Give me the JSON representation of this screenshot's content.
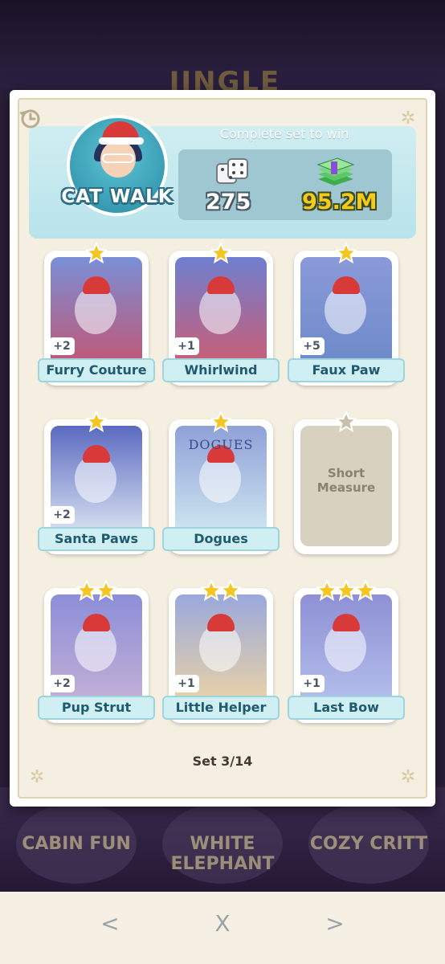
{
  "background": {
    "peek_title": "JINGLE",
    "bottom_sets": [
      "CABIN FUN",
      "WHITE ELEPHANT",
      "COZY CRITT"
    ]
  },
  "header": {
    "set_name": "CAT WALK",
    "complete_text": "Complete set to win",
    "rewards": {
      "dice": "275",
      "money": "95.2M"
    }
  },
  "cards": [
    {
      "name": "Furry Couture",
      "stars": 1,
      "duplicates": "+2",
      "collected": true
    },
    {
      "name": "Whirlwind",
      "stars": 1,
      "duplicates": "+1",
      "collected": true
    },
    {
      "name": "Faux Paw",
      "stars": 1,
      "duplicates": "+5",
      "collected": true
    },
    {
      "name": "Santa Paws",
      "stars": 1,
      "duplicates": "+2",
      "collected": true
    },
    {
      "name": "Dogues",
      "stars": 1,
      "duplicates": "",
      "collected": true,
      "poster_text": "DOGUES"
    },
    {
      "name": "Short Measure",
      "stars": 1,
      "duplicates": "",
      "collected": false
    },
    {
      "name": "Pup Strut",
      "stars": 2,
      "duplicates": "+2",
      "collected": true
    },
    {
      "name": "Little Helper",
      "stars": 2,
      "duplicates": "+1",
      "collected": true
    },
    {
      "name": "Last Bow",
      "stars": 3,
      "duplicates": "+1",
      "collected": true
    }
  ],
  "footer": {
    "set_count": "Set 3/14"
  },
  "nav": {
    "prev": "<",
    "close": "X",
    "next": ">"
  },
  "colors": {
    "header_bg": "#cfeef2",
    "card_label_bg": "#cfeff3",
    "money": "#f6c91d",
    "star": "#f3c623",
    "locked_card": "#d9d1bf"
  }
}
